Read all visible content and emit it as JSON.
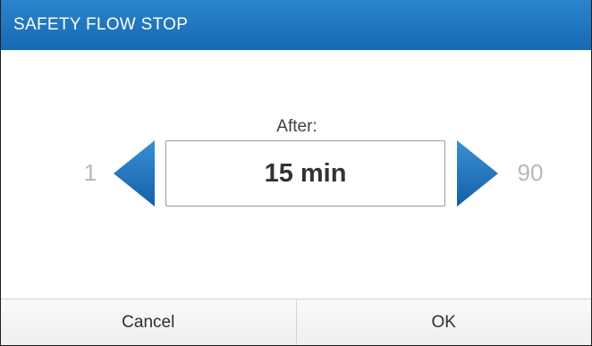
{
  "dialog": {
    "title": "SAFETY FLOW STOP",
    "label": "After:",
    "value": "15 min",
    "min": "1",
    "max": "90",
    "decrease_icon": "triangle-left-icon",
    "increase_icon": "triangle-right-icon",
    "cancel_label": "Cancel",
    "ok_label": "OK"
  },
  "colors": {
    "title_bar": "#1e72bd",
    "arrow": "#1b72c0",
    "range_text": "#b8b8b8"
  }
}
